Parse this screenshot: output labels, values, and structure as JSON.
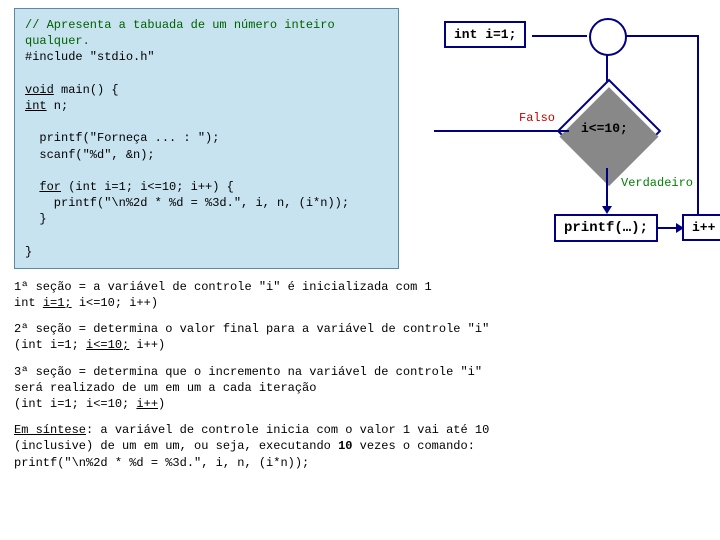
{
  "code": {
    "comment": "// Apresenta a tabuada de um número inteiro qualquer.",
    "include": "#include \"stdio.h\"",
    "main_sig": "void main() {",
    "kw_void": "void",
    "kw_int": "int",
    "decl": " n;",
    "printf1": "  printf(\"Forneça ... : \");",
    "scanf": "  scanf(\"%d\", &n);",
    "for_kw": "for",
    "for_rest": " (int i=1; i<=10; i++) {",
    "printf2": "    printf(\"\\n%2d * %d = %3d.\", i, n, (i*n));",
    "close1": "  }",
    "close2": "}"
  },
  "flow": {
    "init": "int i=1;",
    "cond": "i<=10;",
    "falso": "Falso",
    "verdadeiro": "Verdadeiro",
    "action": "printf(…);",
    "incr": "i++"
  },
  "notes": {
    "s1a": "1ª seção = a variável de controle \"i\" é inicializada com 1",
    "s1b_pre": "int ",
    "s1b_u": "i=1;",
    "s1b_post": " i<=10; i++)",
    "s2a": "2ª seção = determina o valor final para a variável de controle \"i\"",
    "s2b_pre": "(int i=1; ",
    "s2b_u": "i<=10;",
    "s2b_post": " i++)",
    "s3a": "3ª seção = determina que o incremento na variável de controle \"i\"",
    "s3b": "será realizado de um em um a cada iteração",
    "s3c_pre": "(int i=1; i<=10; ",
    "s3c_u": "i++",
    "s3c_post": ")",
    "syn_u": "Em síntese",
    "syn1": ": a variável de controle inicia com o valor 1 vai até 10",
    "syn2_pre": "(inclusive) de um em um, ou seja, executando ",
    "syn2_b": "10",
    "syn2_post": " vezes o comando:",
    "syn3": "printf(\"\\n%2d * %d = %3d.\", i, n, (i*n));"
  }
}
